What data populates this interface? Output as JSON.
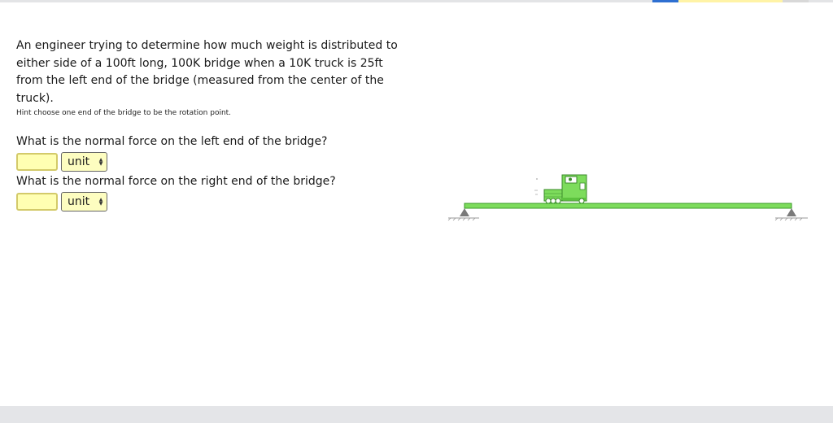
{
  "problem": {
    "text": "An engineer trying to determine how much weight is distributed to either side of a 100ft long, 100K bridge when a 10K truck is 25ft from the left end of the bridge (measured from the center of the truck).",
    "hint": "Hint choose one end of the bridge to be the rotation point."
  },
  "questions": [
    {
      "label": "What is the normal force on the left end of the bridge?",
      "value": "",
      "unit": "unit"
    },
    {
      "label": "What is the normal force on the right end of the bridge?",
      "value": "",
      "unit": "unit"
    }
  ],
  "diagram": {
    "bridge_color": "#7ddc5c",
    "bridge_border": "#3a9a28",
    "support_color": "#7a7a7a",
    "truck_color": "#7ddc5c",
    "icons": [
      "bridge-beam",
      "truck-icon",
      "pin-support-left",
      "pin-support-right"
    ]
  },
  "colors": {
    "input_bg": "#ffffb2",
    "input_border": "#d3ca6a",
    "select_bg": "#fdfdc0",
    "top_strip": [
      "#2e6fd1",
      "#fff3a6",
      "#fff3a6",
      "#fff3a6",
      "#fff3a6",
      "#d8d8d8"
    ]
  }
}
